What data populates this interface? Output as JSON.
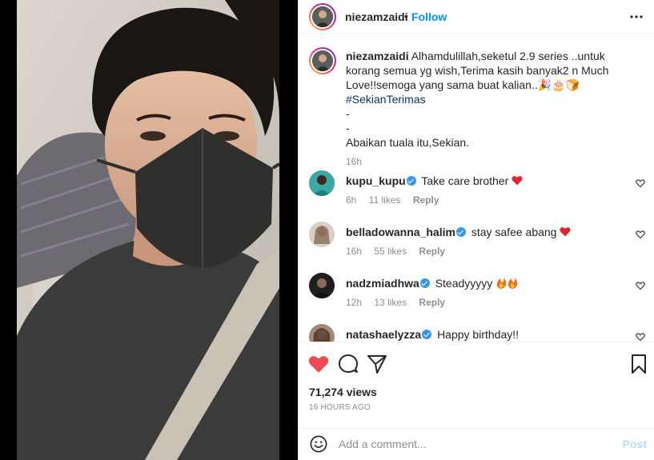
{
  "post": {
    "username": "niezamzaidi",
    "separator": "•",
    "follow_label": "Follow",
    "more_icon": "more-options-icon"
  },
  "caption": {
    "username": "niezamzaidi",
    "text_part1": "Alhamdulillah,seketul 2.9 series ..untuk korang semua yg wish,Terima kasih banyak2 n Much Love!!semoga yang sama buat kalian..",
    "emojis": "🎉🎂🍞",
    "hashtag": "#SekianTerimas",
    "line2": "-",
    "line3": "-",
    "line4": "Abaikan tuala itu,Sekian.",
    "time": "16h"
  },
  "comments": [
    {
      "username": "kupu_kupu",
      "text": "Take care brother",
      "emoji": "heart",
      "time": "6h",
      "likes": "11 likes",
      "reply": "Reply"
    },
    {
      "username": "belladowanna_halim",
      "text": "stay safee abang",
      "emoji": "heart",
      "time": "16h",
      "likes": "55 likes",
      "reply": "Reply"
    },
    {
      "username": "nadzmiadhwa",
      "text": "Steadyyyyy",
      "emoji": "fire",
      "time": "12h",
      "likes": "13 likes",
      "reply": "Reply"
    },
    {
      "username": "natashaelyzza",
      "text": "Happy birthday!!",
      "emoji": "",
      "time": "",
      "likes": "",
      "reply": ""
    }
  ],
  "actions": {
    "views": "71,274 views",
    "time_ago": "16 HOURS AGO"
  },
  "add_comment": {
    "placeholder": "Add a comment...",
    "post_label": "Post"
  },
  "colors": {
    "accent": "#0095f6",
    "liked": "#ed4956",
    "muted": "#8e8e8e",
    "post_disabled": "#b2dffc"
  }
}
